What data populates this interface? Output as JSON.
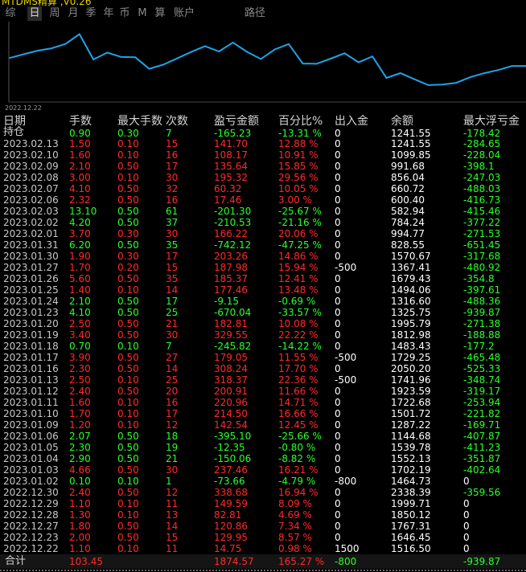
{
  "app": {
    "title": "MTDMS精算 ,V0.26"
  },
  "tabs": [
    {
      "label": "综",
      "active": false
    },
    {
      "label": "日",
      "active": true
    },
    {
      "label": "周",
      "active": false
    },
    {
      "label": "月",
      "active": false
    },
    {
      "label": "季",
      "active": false
    },
    {
      "label": "年",
      "active": false
    },
    {
      "label": "币",
      "active": false
    },
    {
      "label": "M",
      "active": false
    },
    {
      "label": "算",
      "active": false
    },
    {
      "label": "账户",
      "active": false
    },
    {
      "label": "路径",
      "active": false
    }
  ],
  "chart_data": {
    "type": "line",
    "x_start_label": "2022.12.22",
    "color": "#1ea3e6",
    "values": [
      1516.5,
      1646.45,
      1767.31,
      1850.12,
      1999.71,
      2338.39,
      1464.73,
      1702.19,
      1552.13,
      1539.78,
      1144.68,
      1287.22,
      1501.72,
      1722.68,
      1923.59,
      1741.96,
      2050.2,
      1729.25,
      1483.43,
      1812.98,
      1995.79,
      1325.75,
      1316.6,
      1494.06,
      1679.43,
      1367.41,
      1570.67,
      828.55,
      994.77,
      784.24,
      582.94,
      600.4,
      660.72,
      856.04,
      991.68,
      1099.85,
      1241.55,
      1241.55
    ],
    "ylim": [
      0,
      2600
    ]
  },
  "table": {
    "headers": [
      "日期",
      "手数",
      "最大手数",
      "次数",
      "盈亏金额",
      "百分比%",
      "出入金",
      "余额",
      "最大浮亏金"
    ],
    "holding": {
      "label": "持仓",
      "lots": "0.90",
      "max_lots": "0.30",
      "count": "7",
      "pnl": "-165.23",
      "pct": "-13.31 %",
      "inout": "0",
      "balance": "1241.55",
      "max_float": "-178.42",
      "sign": "neg"
    },
    "rows": [
      {
        "date": "2023.02.13",
        "lots": "1.50",
        "max_lots": "0.10",
        "count": "15",
        "pnl": "141.70",
        "pct": "12.88 %",
        "inout": "0",
        "balance": "1241.55",
        "max_float": "-284.65",
        "sign": "pos"
      },
      {
        "date": "2023.02.10",
        "lots": "1.60",
        "max_lots": "0.10",
        "count": "16",
        "pnl": "108.17",
        "pct": "10.91 %",
        "inout": "0",
        "balance": "1099.85",
        "max_float": "-228.04",
        "sign": "pos"
      },
      {
        "date": "2023.02.09",
        "lots": "2.10",
        "max_lots": "0.50",
        "count": "17",
        "pnl": "135.64",
        "pct": "15.85 %",
        "inout": "0",
        "balance": "991.68",
        "max_float": "-398.1",
        "sign": "pos"
      },
      {
        "date": "2023.02.08",
        "lots": "3.00",
        "max_lots": "0.10",
        "count": "30",
        "pnl": "195.32",
        "pct": "29.56 %",
        "inout": "0",
        "balance": "856.04",
        "max_float": "-247.03",
        "sign": "pos"
      },
      {
        "date": "2023.02.07",
        "lots": "4.10",
        "max_lots": "0.50",
        "count": "32",
        "pnl": "60.32",
        "pct": "10.05 %",
        "inout": "0",
        "balance": "660.72",
        "max_float": "-488.03",
        "sign": "pos"
      },
      {
        "date": "2023.02.06",
        "lots": "2.32",
        "max_lots": "0.50",
        "count": "16",
        "pnl": "17.46",
        "pct": "3.00 %",
        "inout": "0",
        "balance": "600.40",
        "max_float": "-416.73",
        "sign": "pos"
      },
      {
        "date": "2023.02.03",
        "lots": "13.10",
        "max_lots": "0.50",
        "count": "61",
        "pnl": "-201.30",
        "pct": "-25.67 %",
        "inout": "0",
        "balance": "582.94",
        "max_float": "-415.46",
        "sign": "neg"
      },
      {
        "date": "2023.02.02",
        "lots": "4.20",
        "max_lots": "0.50",
        "count": "37",
        "pnl": "-210.53",
        "pct": "-21.16 %",
        "inout": "0",
        "balance": "784.24",
        "max_float": "-377.22",
        "sign": "neg"
      },
      {
        "date": "2023.02.01",
        "lots": "3.70",
        "max_lots": "0.30",
        "count": "30",
        "pnl": "166.22",
        "pct": "20.06 %",
        "inout": "0",
        "balance": "994.77",
        "max_float": "-271.53",
        "sign": "pos"
      },
      {
        "date": "2023.01.31",
        "lots": "6.20",
        "max_lots": "0.50",
        "count": "35",
        "pnl": "-742.12",
        "pct": "-47.25 %",
        "inout": "0",
        "balance": "828.55",
        "max_float": "-651.45",
        "sign": "neg"
      },
      {
        "date": "2023.01.30",
        "lots": "1.90",
        "max_lots": "0.30",
        "count": "17",
        "pnl": "203.26",
        "pct": "14.86 %",
        "inout": "0",
        "balance": "1570.67",
        "max_float": "-317.68",
        "sign": "pos"
      },
      {
        "date": "2023.01.27",
        "lots": "1.70",
        "max_lots": "0.20",
        "count": "15",
        "pnl": "187.98",
        "pct": "15.94 %",
        "inout": "-500",
        "balance": "1367.41",
        "max_float": "-480.92",
        "sign": "pos"
      },
      {
        "date": "2023.01.26",
        "lots": "5.60",
        "max_lots": "0.50",
        "count": "35",
        "pnl": "185.37",
        "pct": "12.41 %",
        "inout": "0",
        "balance": "1679.43",
        "max_float": "-354.8",
        "sign": "pos"
      },
      {
        "date": "2023.01.25",
        "lots": "1.40",
        "max_lots": "0.10",
        "count": "14",
        "pnl": "177.46",
        "pct": "13.48 %",
        "inout": "0",
        "balance": "1494.06",
        "max_float": "-397.61",
        "sign": "pos"
      },
      {
        "date": "2023.01.24",
        "lots": "2.10",
        "max_lots": "0.50",
        "count": "17",
        "pnl": "-9.15",
        "pct": "-0.69 %",
        "inout": "0",
        "balance": "1316.60",
        "max_float": "-488.36",
        "sign": "neg"
      },
      {
        "date": "2023.01.23",
        "lots": "4.10",
        "max_lots": "0.50",
        "count": "25",
        "pnl": "-670.04",
        "pct": "-33.57 %",
        "inout": "0",
        "balance": "1325.75",
        "max_float": "-939.87",
        "sign": "neg"
      },
      {
        "date": "2023.01.20",
        "lots": "2.50",
        "max_lots": "0.50",
        "count": "21",
        "pnl": "182.81",
        "pct": "10.08 %",
        "inout": "0",
        "balance": "1995.79",
        "max_float": "-271.38",
        "sign": "pos"
      },
      {
        "date": "2023.01.19",
        "lots": "3.40",
        "max_lots": "0.50",
        "count": "30",
        "pnl": "329.55",
        "pct": "22.22 %",
        "inout": "0",
        "balance": "1812.98",
        "max_float": "-188.88",
        "sign": "pos"
      },
      {
        "date": "2023.01.18",
        "lots": "0.70",
        "max_lots": "0.10",
        "count": "7",
        "pnl": "-245.82",
        "pct": "-14.22 %",
        "inout": "0",
        "balance": "1483.43",
        "max_float": "-177.2",
        "sign": "neg"
      },
      {
        "date": "2023.01.17",
        "lots": "3.90",
        "max_lots": "0.50",
        "count": "27",
        "pnl": "179.05",
        "pct": "11.55 %",
        "inout": "-500",
        "balance": "1729.25",
        "max_float": "-465.48",
        "sign": "pos"
      },
      {
        "date": "2023.01.16",
        "lots": "2.30",
        "max_lots": "0.50",
        "count": "14",
        "pnl": "308.24",
        "pct": "17.70 %",
        "inout": "0",
        "balance": "2050.20",
        "max_float": "-525.33",
        "sign": "pos"
      },
      {
        "date": "2023.01.13",
        "lots": "2.50",
        "max_lots": "0.10",
        "count": "25",
        "pnl": "318.37",
        "pct": "22.36 %",
        "inout": "-500",
        "balance": "1741.96",
        "max_float": "-348.74",
        "sign": "pos"
      },
      {
        "date": "2023.01.12",
        "lots": "2.40",
        "max_lots": "0.50",
        "count": "20",
        "pnl": "200.91",
        "pct": "11.66 %",
        "inout": "0",
        "balance": "1923.59",
        "max_float": "-319.17",
        "sign": "pos"
      },
      {
        "date": "2023.01.11",
        "lots": "1.60",
        "max_lots": "0.10",
        "count": "16",
        "pnl": "220.96",
        "pct": "14.71 %",
        "inout": "0",
        "balance": "1722.68",
        "max_float": "-253.94",
        "sign": "pos"
      },
      {
        "date": "2023.01.10",
        "lots": "1.70",
        "max_lots": "0.10",
        "count": "17",
        "pnl": "214.50",
        "pct": "16.66 %",
        "inout": "0",
        "balance": "1501.72",
        "max_float": "-221.82",
        "sign": "pos"
      },
      {
        "date": "2023.01.09",
        "lots": "1.20",
        "max_lots": "0.10",
        "count": "12",
        "pnl": "142.54",
        "pct": "12.45 %",
        "inout": "0",
        "balance": "1287.22",
        "max_float": "-169.71",
        "sign": "pos"
      },
      {
        "date": "2023.01.06",
        "lots": "2.07",
        "max_lots": "0.50",
        "count": "18",
        "pnl": "-395.10",
        "pct": "-25.66 %",
        "inout": "0",
        "balance": "1144.68",
        "max_float": "-407.87",
        "sign": "neg"
      },
      {
        "date": "2023.01.05",
        "lots": "2.30",
        "max_lots": "0.50",
        "count": "19",
        "pnl": "-12.35",
        "pct": "-0.80 %",
        "inout": "0",
        "balance": "1539.78",
        "max_float": "-411.23",
        "sign": "neg"
      },
      {
        "date": "2023.01.04",
        "lots": "2.90",
        "max_lots": "0.50",
        "count": "21",
        "pnl": "-150.06",
        "pct": "-8.82 %",
        "inout": "0",
        "balance": "1552.13",
        "max_float": "-351.87",
        "sign": "neg"
      },
      {
        "date": "2023.01.03",
        "lots": "4.66",
        "max_lots": "0.50",
        "count": "30",
        "pnl": "237.46",
        "pct": "16.21 %",
        "inout": "0",
        "balance": "1702.19",
        "max_float": "-402.64",
        "sign": "pos"
      },
      {
        "date": "2023.01.02",
        "lots": "0.10",
        "max_lots": "0.10",
        "count": "1",
        "pnl": "-73.66",
        "pct": "-4.79 %",
        "inout": "-800",
        "balance": "1464.73",
        "max_float": "0",
        "sign": "neg"
      },
      {
        "date": "2022.12.30",
        "lots": "2.40",
        "max_lots": "0.50",
        "count": "12",
        "pnl": "338.68",
        "pct": "16.94 %",
        "inout": "0",
        "balance": "2338.39",
        "max_float": "-359.56",
        "sign": "pos"
      },
      {
        "date": "2022.12.29",
        "lots": "1.10",
        "max_lots": "0.10",
        "count": "11",
        "pnl": "149.59",
        "pct": "8.09 %",
        "inout": "0",
        "balance": "1999.71",
        "max_float": "0",
        "sign": "pos"
      },
      {
        "date": "2022.12.28",
        "lots": "1.30",
        "max_lots": "0.10",
        "count": "13",
        "pnl": "82.81",
        "pct": "4.69 %",
        "inout": "0",
        "balance": "1850.12",
        "max_float": "0",
        "sign": "pos"
      },
      {
        "date": "2022.12.27",
        "lots": "1.80",
        "max_lots": "0.50",
        "count": "14",
        "pnl": "120.86",
        "pct": "7.34 %",
        "inout": "0",
        "balance": "1767.31",
        "max_float": "0",
        "sign": "pos"
      },
      {
        "date": "2022.12.23",
        "lots": "2.00",
        "max_lots": "0.50",
        "count": "15",
        "pnl": "129.95",
        "pct": "8.57 %",
        "inout": "0",
        "balance": "1646.45",
        "max_float": "0",
        "sign": "pos"
      },
      {
        "date": "2022.12.22",
        "lots": "1.10",
        "max_lots": "0.10",
        "count": "11",
        "pnl": "14.75",
        "pct": "0.98 %",
        "inout": "1500",
        "balance": "1516.50",
        "max_float": "0",
        "sign": "pos"
      }
    ],
    "total": {
      "label": "合计",
      "lots": "103.45",
      "pnl": "1874.57",
      "pct": "165.27 %",
      "inout": "-800",
      "max_float": "-939.87"
    }
  },
  "colors": {
    "profit": "#ff2a2a",
    "loss": "#2aff2a",
    "line": "#1ea3e6",
    "title": "#e6d200"
  }
}
